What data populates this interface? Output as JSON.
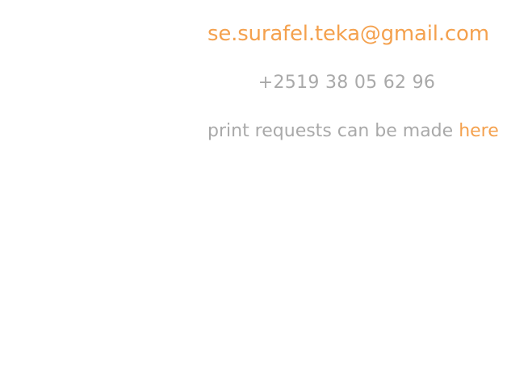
{
  "colors": {
    "accent": "#f4a14e",
    "text": "#a9a9a9",
    "background": "#ffffff"
  },
  "contact": {
    "email": "se.surafel.teka@gmail.com",
    "phone": "+2519 38 05 62 96",
    "print_text": "print requests can be made ",
    "print_link": "here"
  }
}
